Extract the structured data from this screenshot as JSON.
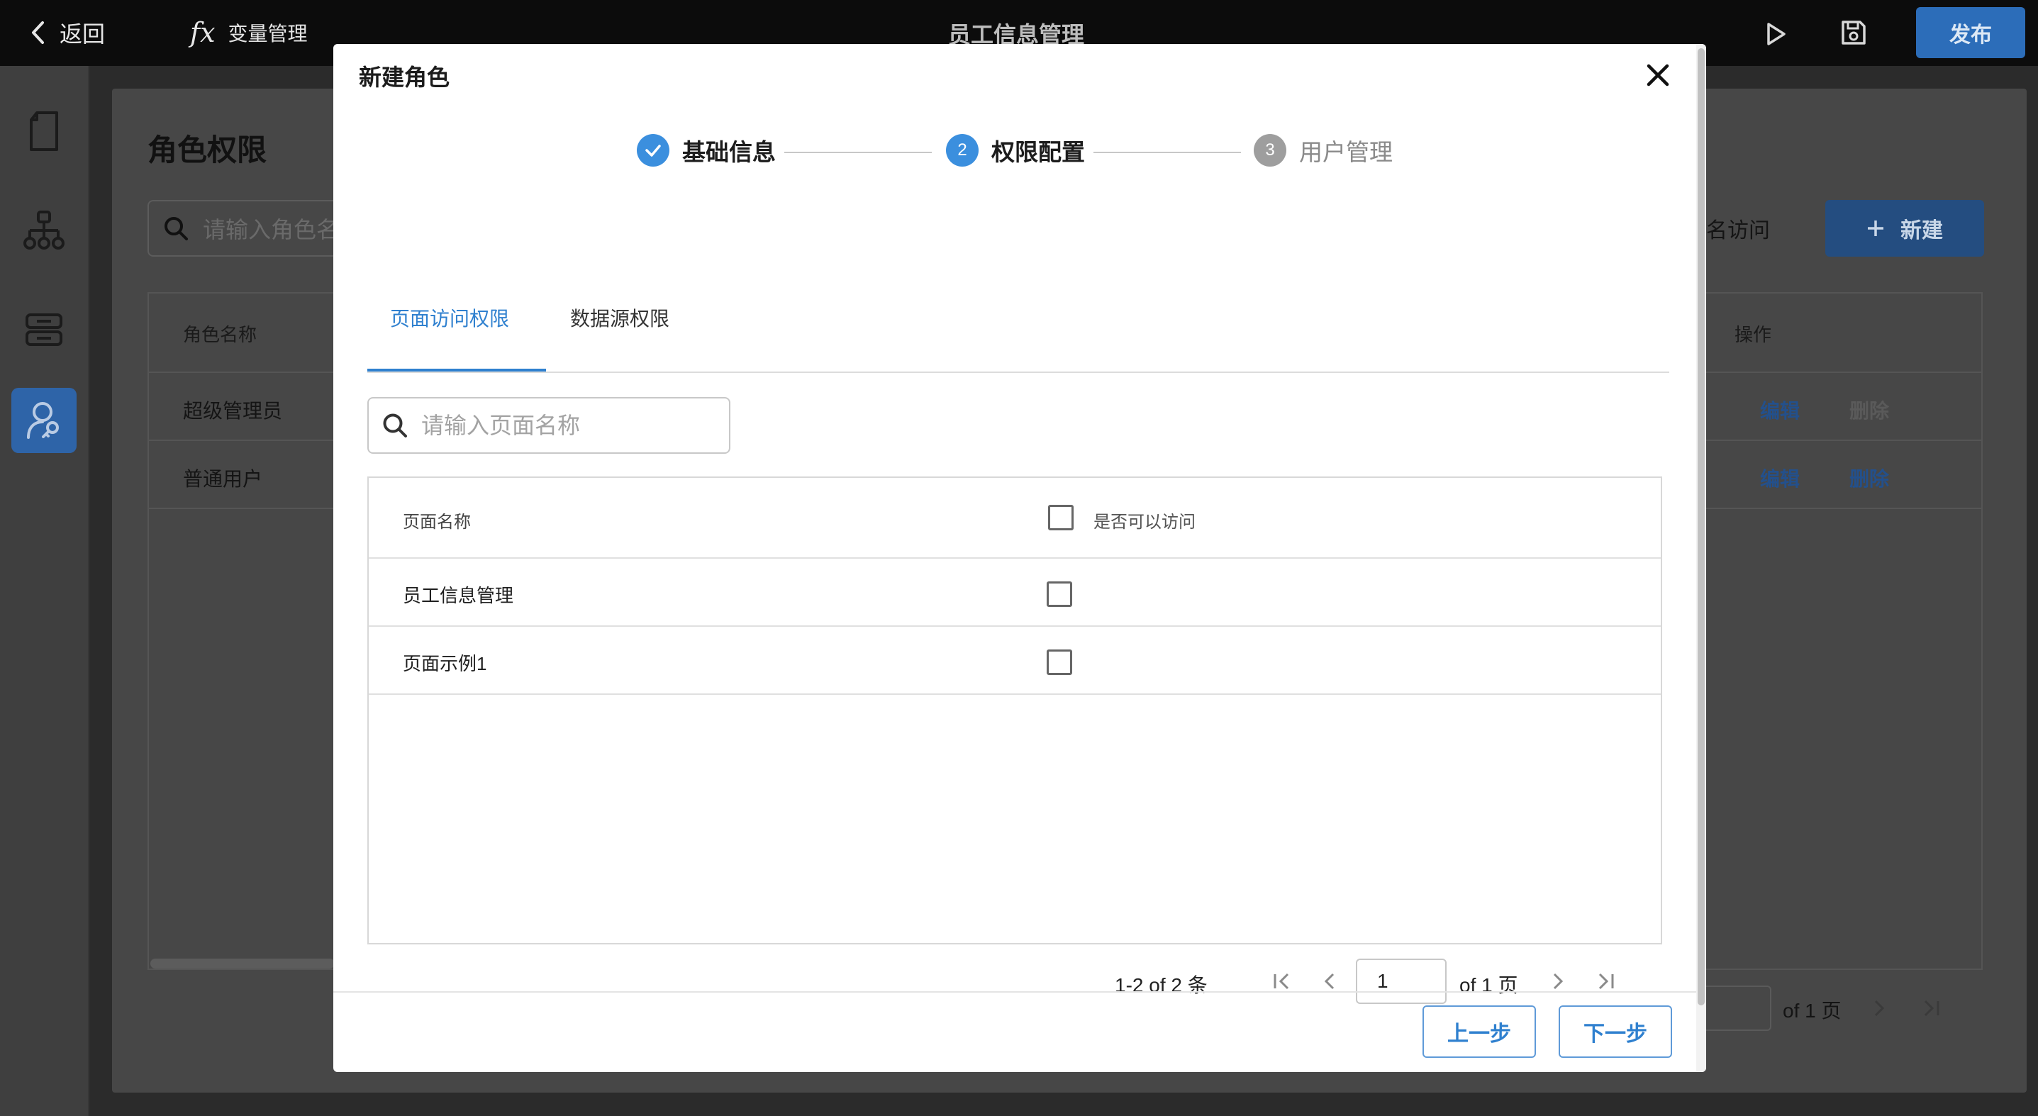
{
  "topbar": {
    "back_label": "返回",
    "variables_fx": "fx",
    "variables_label": "变量管理",
    "title": "员工信息管理",
    "publish_label": "发布"
  },
  "background": {
    "page_title": "角色权限",
    "search_placeholder": "请输入角色名",
    "anonymous_access_label": "名访问",
    "new_button_label": "新建",
    "columns": {
      "role_name": "角色名称",
      "actions": "操作"
    },
    "rows": [
      {
        "name": "超级管理员",
        "edit": "编辑",
        "delete": "删除"
      },
      {
        "name": "普通用户",
        "edit": "编辑",
        "delete": "删除"
      }
    ],
    "pager_of": "of 1 页"
  },
  "modal": {
    "title": "新建角色",
    "steps": [
      {
        "number": "1",
        "label": "基础信息",
        "status": "done"
      },
      {
        "number": "2",
        "label": "权限配置",
        "status": "active"
      },
      {
        "number": "3",
        "label": "用户管理",
        "status": "pending"
      }
    ],
    "tabs": [
      {
        "label": "页面访问权限",
        "active": true
      },
      {
        "label": "数据源权限",
        "active": false
      }
    ],
    "search_placeholder": "请输入页面名称",
    "table": {
      "header_name": "页面名称",
      "header_access": "是否可以访问",
      "rows": [
        {
          "name": "员工信息管理",
          "access": false
        },
        {
          "name": "页面示例1",
          "access": false
        }
      ]
    },
    "pager": {
      "count_text": "1-2 of 2 条",
      "page_value": "1",
      "of_text": "of 1 页"
    },
    "prev_label": "上一步",
    "next_label": "下一步"
  },
  "colors": {
    "accent": "#2f80cf",
    "publish": "#2c6db9",
    "step_done": "#3b8fde",
    "step_pending": "#9e9e9e"
  }
}
